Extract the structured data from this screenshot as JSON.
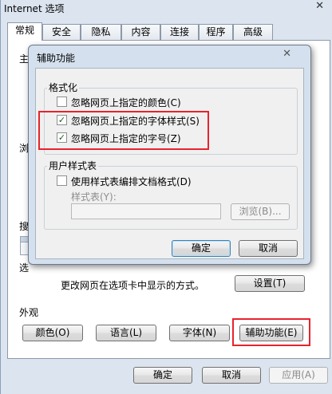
{
  "window": {
    "title": "Internet 选项",
    "close_glyph": "✕"
  },
  "tabs": [
    "常规",
    "安全",
    "隐私",
    "内容",
    "连接",
    "程序",
    "高级"
  ],
  "main": {
    "partial_labels": [
      "主",
      "浏",
      "搜",
      "选"
    ],
    "tabs_desc": "更改网页在选项卡中显示的方式。",
    "tabs_settings_button": "设置(T)",
    "appearance_title": "外观",
    "appearance_buttons": [
      "颜色(O)",
      "语言(L)",
      "字体(N)",
      "辅助功能(E)"
    ]
  },
  "footer": {
    "ok": "确定",
    "cancel": "取消",
    "apply": "应用(A)"
  },
  "dialog": {
    "title": "辅助功能",
    "close_glyph": "✕",
    "formatting_title": "格式化",
    "options": [
      {
        "label": "忽略网页上指定的颜色(C)",
        "checked": false
      },
      {
        "label": "忽略网页上指定的字体样式(S)",
        "checked": true
      },
      {
        "label": "忽略网页上指定的字号(Z)",
        "checked": true
      }
    ],
    "stylesheet_title": "用户样式表",
    "stylesheet_option": "使用样式表编排文档格式(D)",
    "stylesheet_label": "样式表(Y):",
    "browse_button": "浏览(B)...",
    "ok_button": "确定",
    "cancel_button": "取消",
    "check_glyph": "✓"
  },
  "colors": {
    "highlight": "#e8232e",
    "default_button_border": "#3c7fb1"
  }
}
